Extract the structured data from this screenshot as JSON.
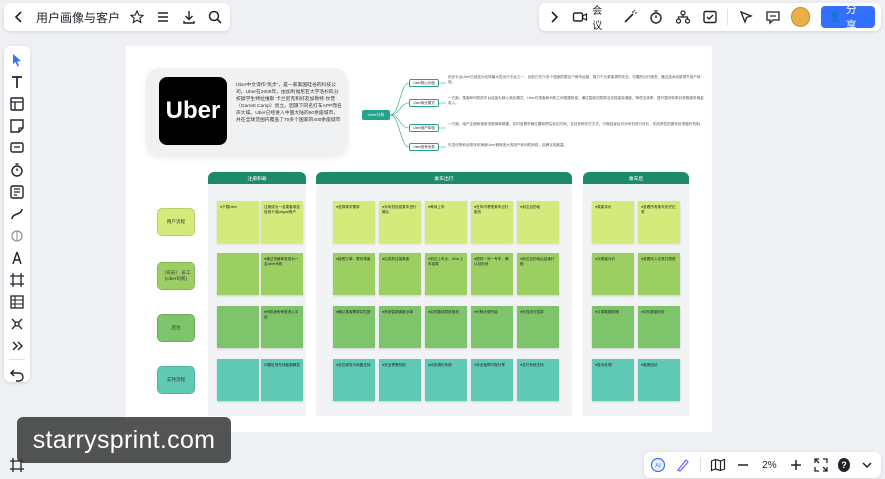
{
  "header": {
    "back_icon": "chevron-left-icon",
    "doc_title": "用户画像与客户体验",
    "star_icon": "star-icon",
    "menu_icon": "menu-icon",
    "download_icon": "download-icon",
    "search_icon": "search-icon",
    "collapse_icon": "chevron-right-icon",
    "meeting_label": "会议",
    "share_label": "分享"
  },
  "toolbar_icons": [
    "cursor-icon",
    "text-icon",
    "layout-icon",
    "sticky-note-icon",
    "comment-icon",
    "timer-icon",
    "template-icon",
    "connector-icon",
    "magic-icon",
    "pen-icon",
    "frame-icon",
    "table-icon",
    "mindmap-icon",
    "more-icon",
    "undo-icon"
  ],
  "board": {
    "uber_card": {
      "logo_text": "Uber",
      "description": "Uber中文译作“优步”，是一家美国硅谷的科技公司。Uber在2009年，由加利福尼亚大学洛杉矶分校辍学生特拉维斯·卡兰尼克和好友加勒特·坎普（Garrett Camp）创立。因旗下同名打车APP而名声大噪。Uber已经进入中国大陆的60余座城市，并在全球范围内覆盖了70多个国家的400余座城市"
    },
    "mindmap": {
      "root": "Uber分析",
      "branches": [
        {
          "label": "Uber核心价值",
          "text": "优步平台Uber已经成为全球最大的出行平台之一，目前已在70多个国家的数百个城市运营，致力于为乘客提供安全、可靠的出行服务，通过技术创新提升用户体验。"
        },
        {
          "label": "Uber商业模式",
          "text": "一方面，乘客和司机的平台连接为核心商业模式，Uber在乘客和司机之间搭建桥梁，通过智能匹配算法实现高效调度，降低空驶率，提升整体效率并获取服务佣金收入。"
        },
        {
          "label": "Uber用户体验",
          "text": "一方面，用户注册和使用流程简单便捷，实时查看车辆位置和预估到达时间，支持多种支付方式，行程结束后可对司机进行评价，形成良性的服务反馈循环机制。"
        },
        {
          "label": "Uber竞争优势",
          "text": "先发优势和全球化布局使Uber拥有庞大的用户和司机网络，品牌认知度高。"
        }
      ]
    },
    "lanes": [
      {
        "title": "注册和载"
      },
      {
        "title": "乘车出行"
      },
      {
        "title": "乘车后"
      }
    ],
    "rows": [
      {
        "label": "用户流程"
      },
      {
        "label": "（司员）\n员工(Uber司机)"
      },
      {
        "label": "后台"
      },
      {
        "label": "支持流程"
      }
    ],
    "stickies": [
      [
        "●下载Uber",
        "注册成为一名乘客绑定信用卡或paypal账户",
        "●选择乘车需求",
        "●对司机信息乘车进行确认",
        "●等待上车",
        "●在车内享受乘车出行服务",
        "●到达目的地",
        "●乘客评价",
        "●查看所有乘车历史记录"
      ],
      [
        "",
        "●通过资格审查成为一名Uber司机",
        "●接受订单，联系乘客",
        "●出发前往接乘客",
        "●到达上车点，Uber上车接乘",
        "●提供一对一专车，确认目的地",
        "●到达目的地后结束行程",
        "●对乘客评价",
        "●查看收入记录并提现"
      ],
      [
        "",
        "●司机身份审查进入平台",
        "●确认乘客需求并匹配",
        "●系统智能调度派单",
        "●实时路线导航规划",
        "●行程计费开始",
        "●在线支付结算",
        "●订单数据存储",
        "●评价数据分析"
      ],
      [
        "",
        "问题反馈在线客服解答",
        "●定位服务与地图支持",
        "●安全预警机制",
        "●动态调价系统",
        "●安全保障行程分享",
        "●支付系统支持",
        "●投诉处理",
        "●客服回访"
      ]
    ]
  },
  "footer": {
    "ai_icon": "ai-assistant-icon",
    "pen_icon": "pen-icon",
    "map_icon": "map-icon",
    "zoom_out_icon": "minus-icon",
    "zoom_level": "2%",
    "zoom_in_icon": "plus-icon",
    "fullscreen_icon": "fullscreen-icon",
    "help_label": "?",
    "more_icon": "chevron-down-icon"
  },
  "watermark": "starrysprint.com",
  "colors": {
    "accent": "#3370ff",
    "lane_green": "#1e8a6c",
    "sticky_lime": "#d4ea7a",
    "sticky_green": "#9ccf62",
    "sticky_mid": "#7ec46a",
    "sticky_teal": "#5fc9b4"
  }
}
